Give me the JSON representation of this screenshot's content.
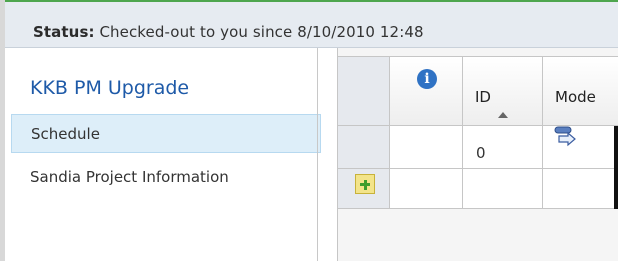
{
  "status": {
    "label": "Status:",
    "text": "Checked-out to you since 8/10/2010 12:48"
  },
  "nav": {
    "title": "KKB PM Upgrade",
    "items": [
      {
        "label": "Schedule",
        "selected": true
      },
      {
        "label": "Sandia Project Information",
        "selected": false
      }
    ]
  },
  "grid": {
    "columns": [
      {
        "key": "info",
        "icon": "info-icon"
      },
      {
        "key": "id",
        "label": "ID",
        "sort": "ascending"
      },
      {
        "key": "mode",
        "label": "Mode"
      }
    ],
    "rows": [
      {
        "id": "0",
        "mode_icon": "task-mode-icon"
      }
    ],
    "add_row_icon": "add-row-icon"
  },
  "colors": {
    "accent_green": "#4ea64e",
    "nav_title": "#1e5aa8",
    "selected_bg": "#ddeef9",
    "info_icon": "#2f72c4"
  }
}
